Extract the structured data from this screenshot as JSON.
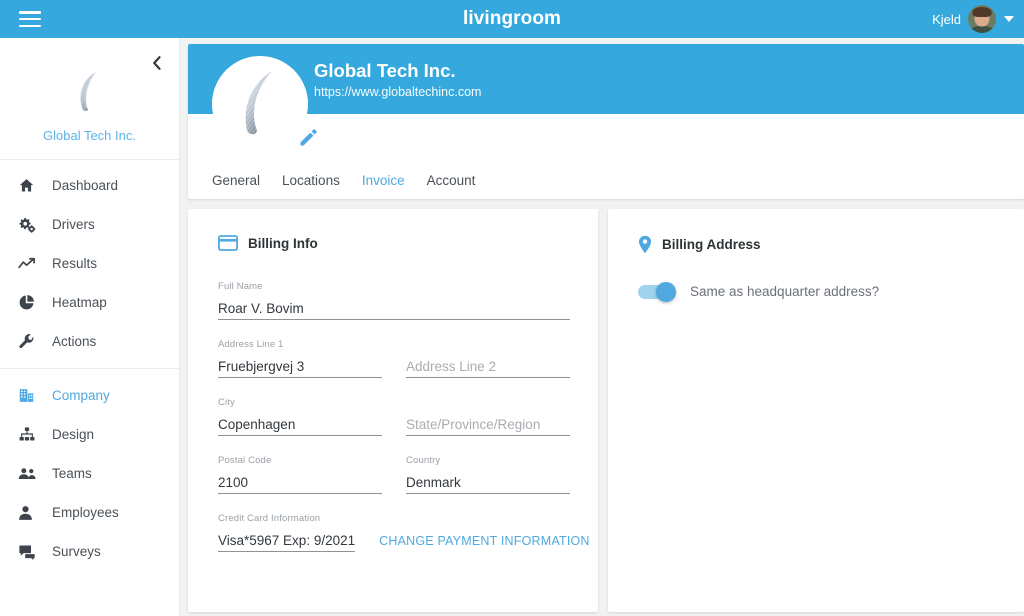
{
  "topbar": {
    "menu_icon": "hamburger-icon",
    "brand": "livingroom",
    "user_name": "Kjeld",
    "avatar_icon": "user-avatar",
    "caret_icon": "chevron-down-icon",
    "background_color": "#35a9de"
  },
  "sidebar": {
    "collapse_icon": "chevron-left-icon",
    "org_logo_icon": "company-logo",
    "org_name": "Global Tech Inc.",
    "items": [
      {
        "label": "Dashboard",
        "icon": "home-icon",
        "active": false
      },
      {
        "label": "Drivers",
        "icon": "gears-icon",
        "active": false
      },
      {
        "label": "Results",
        "icon": "trend-line-icon",
        "active": false
      },
      {
        "label": "Heatmap",
        "icon": "pie-chart-icon",
        "active": false
      },
      {
        "label": "Actions",
        "icon": "wrench-icon",
        "active": false
      },
      {
        "label": "Company",
        "icon": "building-icon",
        "active": true
      },
      {
        "label": "Design",
        "icon": "org-chart-icon",
        "active": false
      },
      {
        "label": "Teams",
        "icon": "people-icon",
        "active": false
      },
      {
        "label": "Employees",
        "icon": "person-icon",
        "active": false
      },
      {
        "label": "Surveys",
        "icon": "chat-bubbles-icon",
        "active": false
      }
    ],
    "separator_after_index": 4
  },
  "profile": {
    "company_name": "Global Tech Inc.",
    "website": "https://www.globaltechinc.com",
    "logo_icon": "company-logo",
    "edit_icon": "pencil-icon",
    "banner_color": "#35a9de",
    "tabs": [
      {
        "label": "General",
        "active": false
      },
      {
        "label": "Locations",
        "active": false
      },
      {
        "label": "Invoice",
        "active": true
      },
      {
        "label": "Account",
        "active": false
      }
    ]
  },
  "billing_info": {
    "icon": "credit-card-icon",
    "title": "Billing Info",
    "fields": {
      "full_name": {
        "label": "Full Name",
        "value": "Roar V. Bovim"
      },
      "address_line_1": {
        "label": "Address Line 1",
        "value": "Fruebjergvej 3"
      },
      "address_line_2": {
        "label": "",
        "placeholder": "Address Line 2",
        "value": ""
      },
      "city": {
        "label": "City",
        "value": "Copenhagen"
      },
      "state": {
        "label": "",
        "placeholder": "State/Province/Region",
        "value": ""
      },
      "postal_code": {
        "label": "Postal Code",
        "value": "2100"
      },
      "country": {
        "label": "Country",
        "value": "Denmark"
      },
      "credit_card": {
        "label": "Credit Card Information",
        "value": "Visa*5967 Exp: 9/2021"
      }
    },
    "change_payment_label": "CHANGE PAYMENT INFORMATION"
  },
  "billing_address": {
    "icon": "location-pin-icon",
    "title": "Billing Address",
    "toggle": {
      "label": "Same as headquarter address?",
      "state": "on",
      "on_color": "#4fa9e0"
    }
  },
  "theme": {
    "accent": "#4fa9e0",
    "page_background": "#f2f2f2",
    "card_background": "#ffffff",
    "text_primary": "#32383d",
    "text_muted": "#9aa0a6"
  }
}
